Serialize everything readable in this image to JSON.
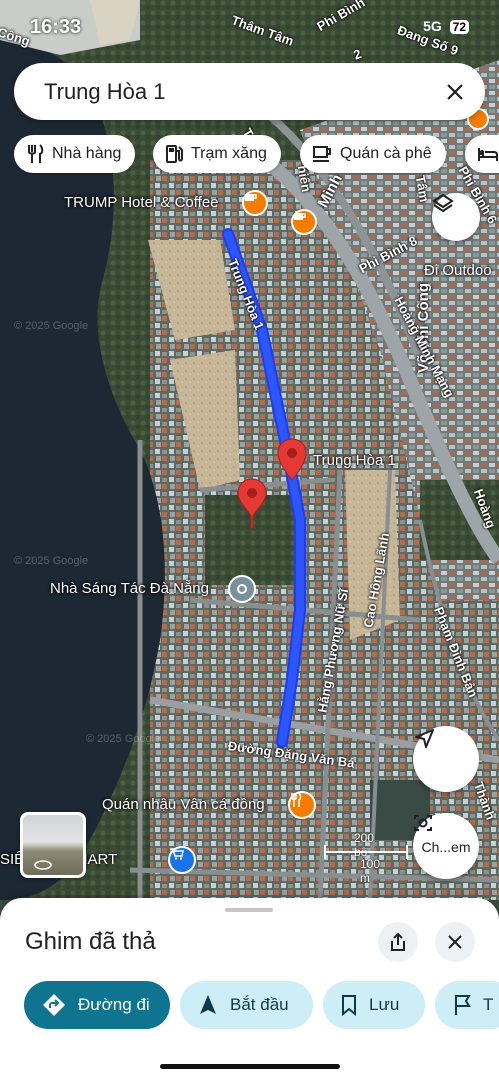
{
  "status": {
    "time": "16:33",
    "network": "5G",
    "battery": "72"
  },
  "search": {
    "query": "Trung Hòa 1"
  },
  "chips": [
    {
      "label": "Nhà hàng",
      "icon": "restaurant-icon"
    },
    {
      "label": "Trạm xăng",
      "icon": "gas-station-icon"
    },
    {
      "label": "Quán cà phê",
      "icon": "coffee-icon"
    },
    {
      "label": "",
      "icon": "hotel-icon"
    }
  ],
  "map": {
    "streets": {
      "trung_hoa_1": "Trung Hòa 1",
      "vo_chi_cong": "Võ Chí Công",
      "hoang_minh_mang": "Hoàng Minh Mạng",
      "phi_binh_8": "Phi Bình 8",
      "phi_binh_6": "Phi Bình 6",
      "minh_map": "Minh",
      "hang_phuong_nu_si": "Hằng Phương Nữ Sĩ",
      "cao_hong_lanh": "Cao Hồng Lãnh",
      "pham_dinh_ban": "Phạm Đình Bản",
      "dang_van_ba": "Đường Đặng Văn Bá",
      "tham_tam": "Thâm Tâm",
      "phi_binh": "Phi Bình",
      "dang_so_9": "Đang Số 9",
      "thanh": "Thành",
      "hoang": "Hoàng",
      "tran": "Trần",
      "hien": "hiến",
      "vo_chi_cong_top": "Võ Chí Công",
      "no2": "2",
      "tam": "Tâm",
      "cong": "Công"
    },
    "pois": {
      "trump": "TRUMP Hotel & Coffee",
      "di_outdoor": "Đi Outdoo",
      "trung_hoa_pin": "Trung Hòa 1",
      "nha_sang_tac": "Nhà Sáng Tác Đà Nẵng",
      "quan_nhau": "Quán nhậu Vân cá đồng",
      "gold_mart": "SIÊ  GOLD MART"
    },
    "watermarks": [
      "© 2025 Google",
      "© 2025 Google",
      "© 2025 Google"
    ],
    "scale": {
      "top": "200 bộ",
      "bottom": "100 m"
    },
    "street_view_button": "Ch...em",
    "colors": {
      "route": "#1a3cff",
      "pin": "#e53935",
      "water": "#1f2b36"
    }
  },
  "sheet": {
    "title": "Ghim đã thả",
    "actions": [
      {
        "label": "Đường đi",
        "icon": "directions-icon"
      },
      {
        "label": "Bắt đầu",
        "icon": "navigation-arrow-icon"
      },
      {
        "label": "Lưu",
        "icon": "bookmark-icon"
      },
      {
        "label": "T",
        "icon": "flag-icon"
      }
    ]
  }
}
